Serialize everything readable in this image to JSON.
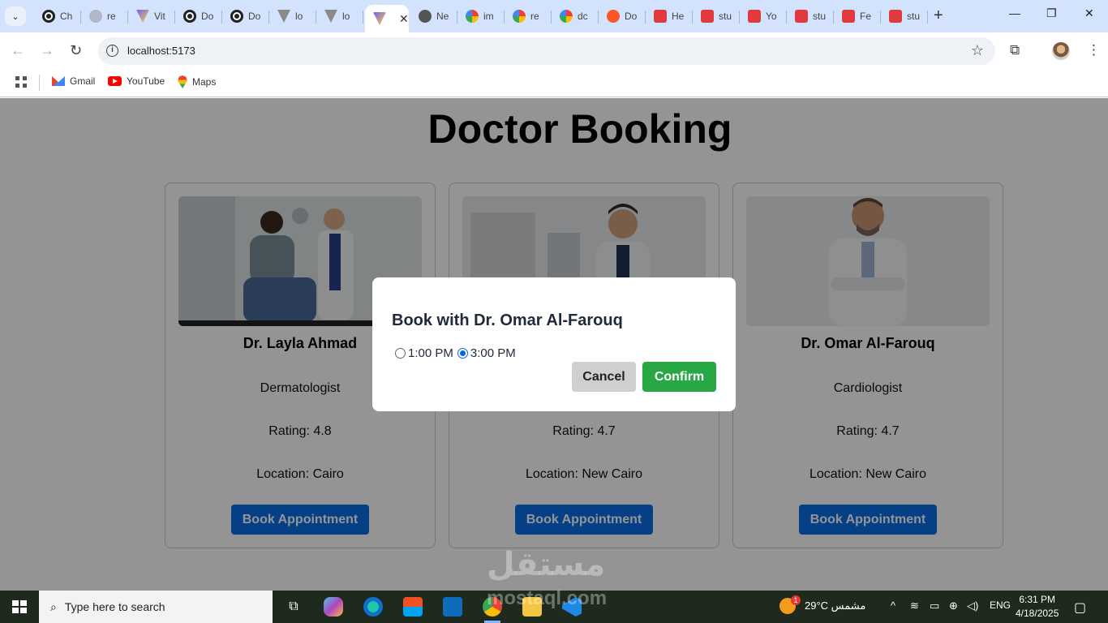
{
  "browser": {
    "tabs": [
      {
        "label": "Ch",
        "icon": "openai-icon"
      },
      {
        "label": "re",
        "icon": "gear-icon"
      },
      {
        "label": "Vit",
        "icon": "vite-icon"
      },
      {
        "label": "Do",
        "icon": "openai-icon"
      },
      {
        "label": "Do",
        "icon": "openai-icon"
      },
      {
        "label": "lo",
        "icon": "feather-icon"
      },
      {
        "label": "lo",
        "icon": "feather-icon"
      },
      {
        "label": "",
        "icon": "vite-icon",
        "active": true
      },
      {
        "label": "Ne",
        "icon": "github-icon"
      },
      {
        "label": "im",
        "icon": "google-icon"
      },
      {
        "label": "re",
        "icon": "google-icon"
      },
      {
        "label": "dc",
        "icon": "google-icon"
      },
      {
        "label": "Do",
        "icon": "brave-icon"
      },
      {
        "label": "He",
        "icon": "red-app-icon"
      },
      {
        "label": "stu",
        "icon": "red-app-icon"
      },
      {
        "label": "Yo",
        "icon": "red-app-icon"
      },
      {
        "label": "stu",
        "icon": "red-app-icon"
      },
      {
        "label": "Fe",
        "icon": "red-app-icon"
      },
      {
        "label": "stu",
        "icon": "red-app-icon"
      }
    ],
    "url": "localhost:5173",
    "bookmarks": [
      {
        "label": "Gmail"
      },
      {
        "label": "YouTube"
      },
      {
        "label": "Maps"
      }
    ]
  },
  "page": {
    "title": "Doctor Booking",
    "doctors": [
      {
        "name": "Dr. Layla Ahmad",
        "specialty": "Dermatologist",
        "rating": "Rating: 4.8",
        "location": "Location: Cairo",
        "button": "Book Appointment"
      },
      {
        "name": "",
        "specialty": "",
        "rating": "Rating: 4.7",
        "location": "Location: New Cairo",
        "button": "Book Appointment"
      },
      {
        "name": "Dr. Omar Al-Farouq",
        "specialty": "Cardiologist",
        "rating": "Rating: 4.7",
        "location": "Location: New Cairo",
        "button": "Book Appointment"
      }
    ],
    "modal": {
      "title": "Book with Dr. Omar Al-Farouq",
      "slots": [
        {
          "label": "1:00 PM",
          "selected": false
        },
        {
          "label": "3:00 PM",
          "selected": true
        }
      ],
      "cancel": "Cancel",
      "confirm": "Confirm"
    },
    "watermark": "مستقل"
  },
  "taskbar": {
    "search_placeholder": "Type here to search",
    "weather": "29°C  مشمس",
    "weather_badge": "1",
    "language": "ENG",
    "time": "6:31 PM",
    "date": "4/18/2025",
    "watermark_url": "mostaql.com"
  }
}
